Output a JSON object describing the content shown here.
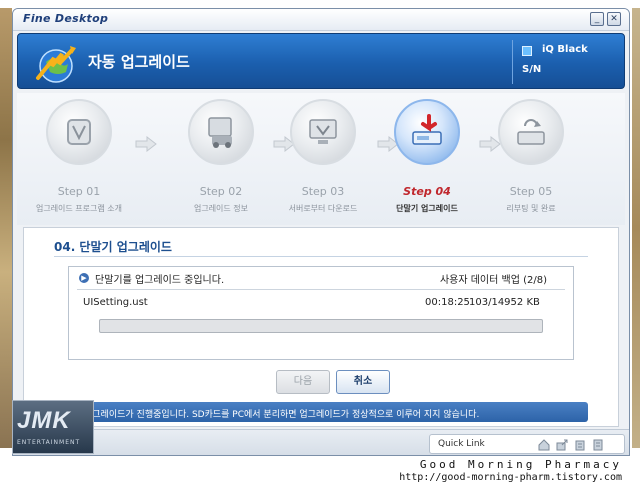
{
  "app": {
    "title": "Fine Desktop",
    "min_icon": "minimize-icon",
    "close_icon": "close-icon"
  },
  "header": {
    "heading": "자동 업그레이드",
    "model": "iQ Black",
    "sn_label": "S/N"
  },
  "steps": [
    {
      "number": "Step 01",
      "label": "업그레이드 프로그램 소개",
      "active": false
    },
    {
      "number": "Step 02",
      "label": "업그레이드 정보",
      "active": false
    },
    {
      "number": "Step 03",
      "label": "서버로부터 다운로드",
      "active": false
    },
    {
      "number": "Step 04",
      "label": "단말기 업그레이드",
      "active": true
    },
    {
      "number": "Step 05",
      "label": "리부팅 및 완료",
      "active": false
    }
  ],
  "main": {
    "section_title": "04. 단말기 업그레이드",
    "status_text": "단말기를 업그레이드 중입니다.",
    "backup_status": "사용자 데이터 백업 (2/8)",
    "file": {
      "name": "UISetting.ust",
      "elapsed": "00:18:25",
      "size": "103/14952 KB",
      "progress_fraction": 0.0
    },
    "buttons": {
      "next": "다음",
      "cancel": "취소"
    },
    "notice": "업그레이드가 진행중입니다. SD카드를 PC에서 분리하면 업그레이드가 정상적으로 이루어 지지 않습니다."
  },
  "footer": {
    "quick_link": "Quick Link"
  },
  "watermark": {
    "letters": "JMK",
    "sub": "ENTERTAINMENT"
  },
  "caption": {
    "line1": "Good Morning Pharmacy",
    "line2": "http://good-morning-pharm.tistory.com"
  },
  "colors": {
    "header_blue": "#1b5fae",
    "active_step_red": "#c0272d",
    "notice_blue": "#2d63a8"
  }
}
